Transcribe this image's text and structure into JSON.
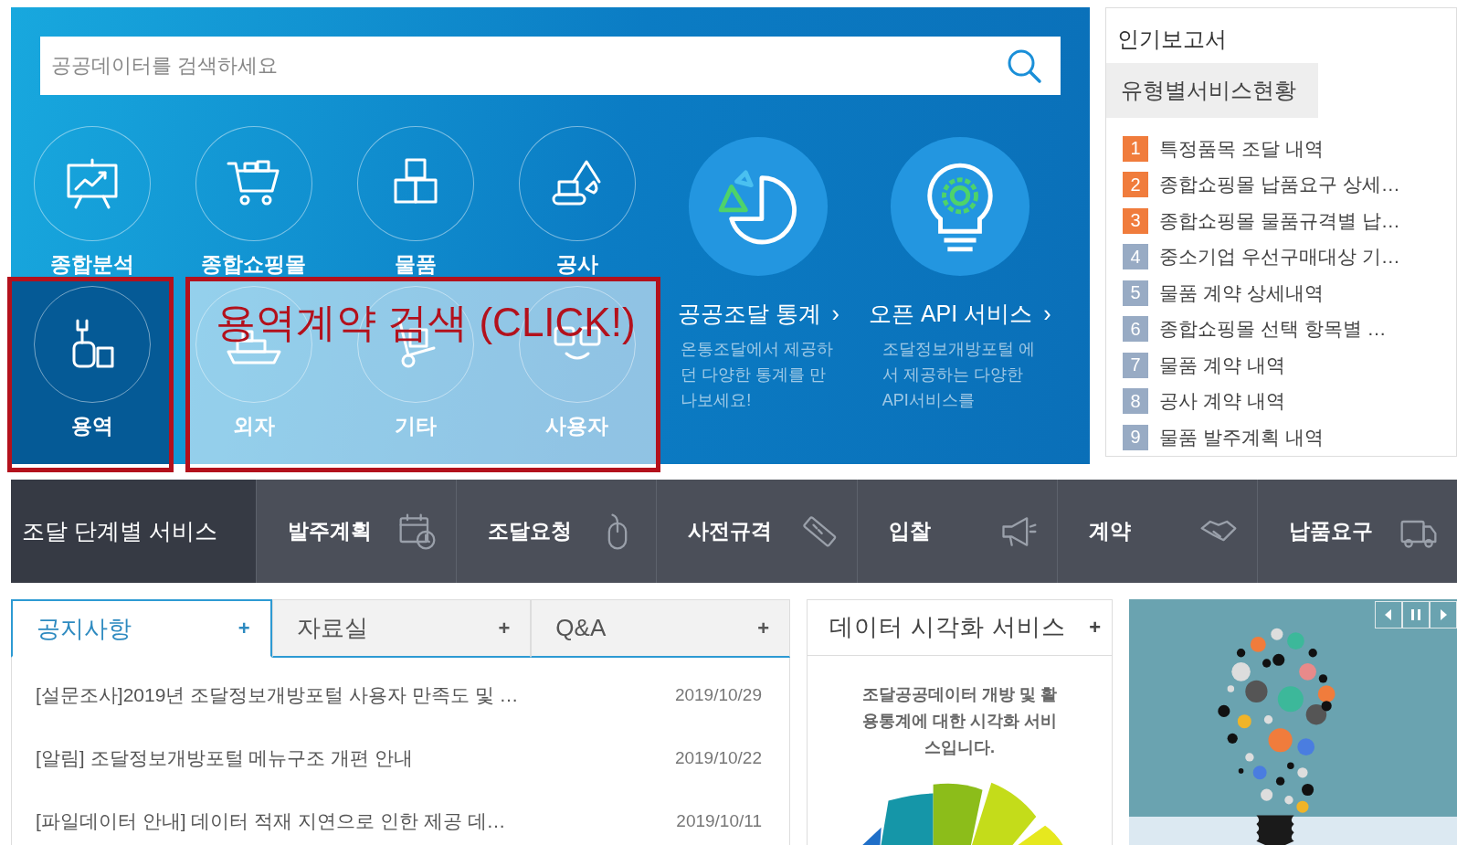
{
  "search": {
    "placeholder": "공공데이터를 검색하세요"
  },
  "categories": [
    {
      "label": "종합분석",
      "selected": false
    },
    {
      "label": "종합쇼핑몰",
      "selected": false
    },
    {
      "label": "물품",
      "selected": false
    },
    {
      "label": "공사",
      "selected": false
    },
    {
      "label": "용역",
      "selected": true
    },
    {
      "label": "외자",
      "selected": false
    },
    {
      "label": "기타",
      "selected": false
    },
    {
      "label": "사용자",
      "selected": false
    }
  ],
  "features": [
    {
      "title": "공공조달 통계",
      "arrow": "›",
      "description": "온통조달에서 제공하던 다양한 통계를 만나보세요!"
    },
    {
      "title": "오픈 API 서비스",
      "arrow": "›",
      "description": "조달정보개방포털 에서 제공하는 다양한 API서비스를"
    }
  ],
  "annotation": {
    "text": "용역계약 검색 (CLICK!)"
  },
  "popular_reports": {
    "title": "인기보고서",
    "tab": "유형별서비스현황",
    "items": [
      {
        "rank": "1",
        "label": "특정품목 조달 내역",
        "color": "#f07c3c"
      },
      {
        "rank": "2",
        "label": "종합쇼핑몰 납품요구 상세…",
        "color": "#f07c3c"
      },
      {
        "rank": "3",
        "label": "종합쇼핑몰 물품규격별 납…",
        "color": "#f07c3c"
      },
      {
        "rank": "4",
        "label": "중소기업 우선구매대상 기…",
        "color": "#98abc4"
      },
      {
        "rank": "5",
        "label": "물품 계약 상세내역",
        "color": "#98abc4"
      },
      {
        "rank": "6",
        "label": "종합쇼핑몰 선택 항목별 …",
        "color": "#98abc4"
      },
      {
        "rank": "7",
        "label": "물품 계약 내역",
        "color": "#98abc4"
      },
      {
        "rank": "8",
        "label": "공사 계약 내역",
        "color": "#98abc4"
      },
      {
        "rank": "9",
        "label": "물품 발주계획 내역",
        "color": "#98abc4"
      }
    ]
  },
  "stage_bar": {
    "title": "조달 단계별 서비스",
    "stages": [
      "발주계획",
      "조달요청",
      "사전규격",
      "입찰",
      "계약",
      "납품요구"
    ]
  },
  "board": {
    "tabs": [
      {
        "label": "공지사항",
        "plus": "+",
        "selected": true
      },
      {
        "label": "자료실",
        "plus": "+",
        "selected": false
      },
      {
        "label": "Q&A",
        "plus": "+",
        "selected": false
      }
    ],
    "notices": [
      {
        "title": "[설문조사]2019년 조달정보개방포털 사용자 만족도 및 …",
        "date": "2019/10/29"
      },
      {
        "title": "[알림] 조달정보개방포털 메뉴구조 개편 안내",
        "date": "2019/10/22"
      },
      {
        "title": "[파일데이터 안내] 데이터 적재 지연으로 인한 제공 데…",
        "date": "2019/10/11"
      }
    ]
  },
  "visualization": {
    "title": "데이터 시각화 서비스",
    "plus": "+",
    "description": "조달공공데이터 개방 및 활용통계에 대한 시각화 서비스입니다."
  }
}
